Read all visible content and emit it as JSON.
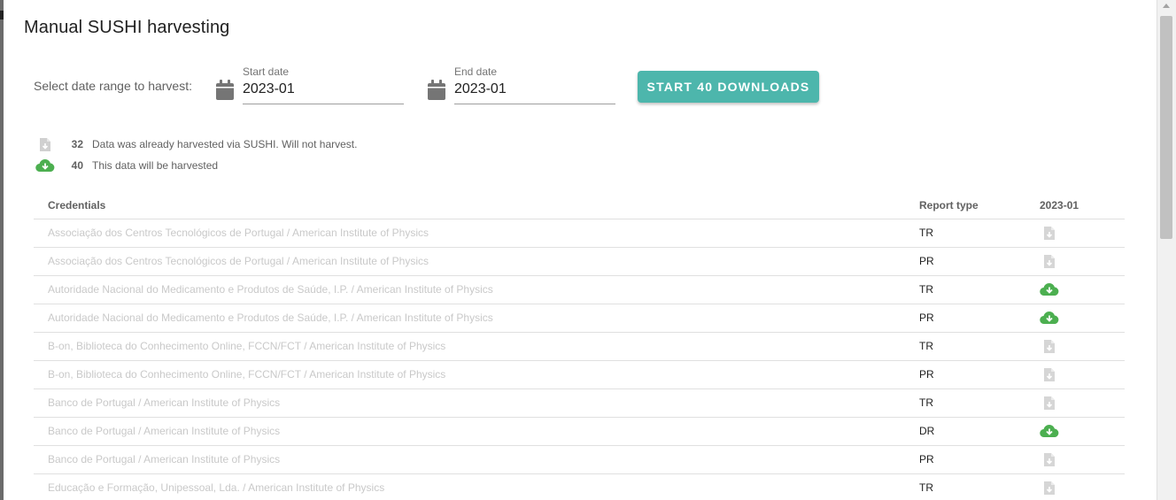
{
  "dialog": {
    "title": "Manual SUSHI harvesting",
    "range_label": "Select date range to harvest:",
    "start_date": {
      "label": "Start date",
      "value": "2023-01"
    },
    "end_date": {
      "label": "End date",
      "value": "2023-01"
    },
    "start_button_label": "START 40 DOWNLOADS"
  },
  "legend": [
    {
      "icon": "file-download-icon",
      "count": "32",
      "text": "Data was already harvested via SUSHI. Will not harvest."
    },
    {
      "icon": "cloud-download-icon",
      "count": "40",
      "text": "This data will be harvested"
    }
  ],
  "table": {
    "headers": {
      "credentials": "Credentials",
      "report_type": "Report type",
      "period": "2023-01"
    },
    "rows": [
      {
        "credential": "Associação dos Centros Tecnológicos de Portugal / American Institute of Physics",
        "report_type": "TR",
        "status": "harvested"
      },
      {
        "credential": "Associação dos Centros Tecnológicos de Portugal / American Institute of Physics",
        "report_type": "PR",
        "status": "harvested"
      },
      {
        "credential": "Autoridade Nacional do Medicamento e Produtos de Saúde, I.P. / American Institute of Physics",
        "report_type": "TR",
        "status": "to-harvest"
      },
      {
        "credential": "Autoridade Nacional do Medicamento e Produtos de Saúde, I.P. / American Institute of Physics",
        "report_type": "PR",
        "status": "to-harvest"
      },
      {
        "credential": "B-on, Biblioteca do Conhecimento Online, FCCN/FCT / American Institute of Physics",
        "report_type": "TR",
        "status": "harvested"
      },
      {
        "credential": "B-on, Biblioteca do Conhecimento Online, FCCN/FCT / American Institute of Physics",
        "report_type": "PR",
        "status": "harvested"
      },
      {
        "credential": "Banco de Portugal / American Institute of Physics",
        "report_type": "TR",
        "status": "harvested"
      },
      {
        "credential": "Banco de Portugal / American Institute of Physics",
        "report_type": "DR",
        "status": "to-harvest"
      },
      {
        "credential": "Banco de Portugal / American Institute of Physics",
        "report_type": "PR",
        "status": "harvested"
      },
      {
        "credential": "Educação e Formação, Unipessoal, Lda. / American Institute of Physics",
        "report_type": "TR",
        "status": "harvested"
      }
    ]
  },
  "colors": {
    "accent": "#4db6ac",
    "to_harvest": "#4caf50",
    "harvested": "#d0d0d0"
  }
}
